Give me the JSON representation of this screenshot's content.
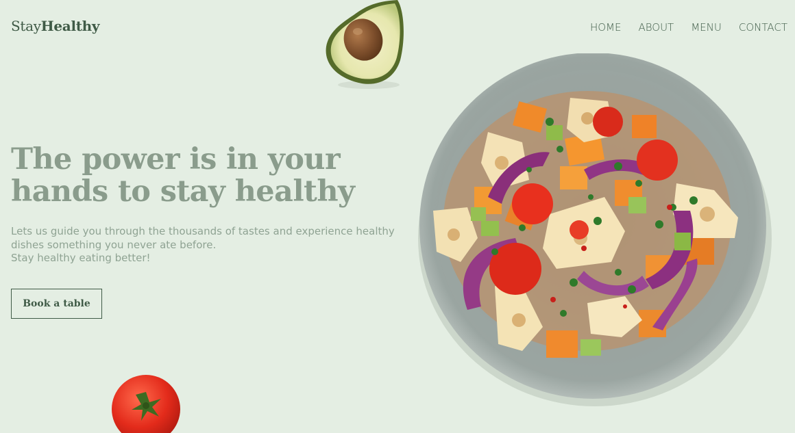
{
  "brand": {
    "logo_light": "Stay",
    "logo_bold": "Healthy"
  },
  "nav": {
    "items": [
      {
        "label": "HOME"
      },
      {
        "label": "ABOUT"
      },
      {
        "label": "MENU"
      },
      {
        "label": "CONTACT"
      }
    ]
  },
  "hero": {
    "headline_line1": "The power is in your",
    "headline_line2": "hands to stay healthy",
    "subtitle_line1": "Lets us guide you through the thousands of tastes and experience healthy",
    "subtitle_line2": "dishes something you never ate before.",
    "subtitle_line3": "Stay healthy eating better!",
    "cta_label": "Book a table"
  },
  "colors": {
    "background": "#e4eee3",
    "brand_dark_green": "#3f5a46",
    "headline_gray_green": "#8a9c8c"
  },
  "images": {
    "avocado": "avocado-half-image",
    "tomato": "tomato-image",
    "salad": "salad-plate-image"
  }
}
